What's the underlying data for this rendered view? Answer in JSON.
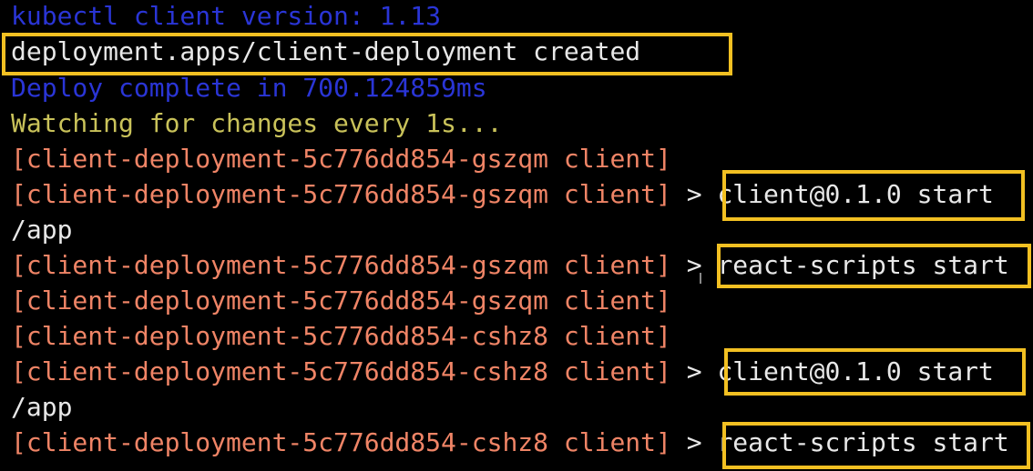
{
  "colors": {
    "background": "#000000",
    "info_blue": "#2a35d6",
    "plain_white": "#e8e8e8",
    "watching_yellow": "#c9c25a",
    "pod_salmon": "#ef8466",
    "highlight_box": "#f2c022"
  },
  "lines": [
    {
      "text": "kubectl client version: 1.13",
      "color": "blue"
    },
    {
      "text": "deployment.apps/client-deployment created",
      "color": "white"
    },
    {
      "text": "Deploy complete in 700.124859ms",
      "color": "blue"
    },
    {
      "text": "Watching for changes every 1s...",
      "color": "yellow"
    },
    {
      "text": "[client-deployment-5c776dd854-gszqm client]",
      "color": "salmon"
    },
    {
      "prefix": "[client-deployment-5c776dd854-gszqm client]",
      "sep": " > ",
      "msg": "client@0.1.0 start"
    },
    {
      "text": "/app",
      "color": "white"
    },
    {
      "prefix": "[client-deployment-5c776dd854-gszqm client]",
      "sep": " > ",
      "msg": "react-scripts start"
    },
    {
      "text": "[client-deployment-5c776dd854-gszqm client]",
      "color": "salmon"
    },
    {
      "text": "[client-deployment-5c776dd854-cshz8 client]",
      "color": "salmon"
    },
    {
      "prefix": "[client-deployment-5c776dd854-cshz8 client]",
      "sep": " > ",
      "msg": "client@0.1.0 start"
    },
    {
      "text": "/app",
      "color": "white"
    },
    {
      "prefix": "[client-deployment-5c776dd854-cshz8 client]",
      "sep": " > ",
      "msg": "react-scripts start"
    }
  ]
}
